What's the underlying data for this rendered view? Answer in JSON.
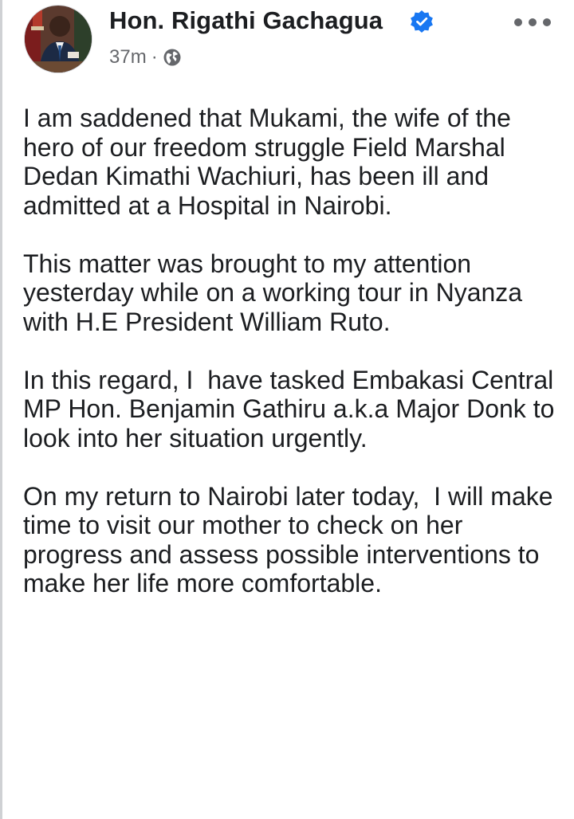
{
  "post": {
    "author": {
      "name": "Hon. Rigathi Gachagua",
      "verified": true,
      "avatar_icon": "profile-photo-icon"
    },
    "timestamp": "37m",
    "separator": "·",
    "audience_icon": "globe-icon",
    "more_icon": "more-options-icon",
    "colors": {
      "text": "#1c1e21",
      "meta": "#65676b",
      "verified_badge": "#1877f2"
    },
    "paragraphs": [
      "I am saddened that Mukami, the wife of the hero of our freedom struggle Field Marshal Dedan Kimathi Wachiuri, has been ill and admitted at a Hospital in Nairobi.",
      "This matter was brought to my attention yesterday while on a working tour in Nyanza with H.E President William Ruto.",
      "In this regard, I  have tasked Embakasi Central MP Hon. Benjamin Gathiru a.k.a Major Donk to look into her situation urgently.",
      "On my return to Nairobi later today,  I will make time to visit our mother to check on her progress and assess possible interventions to make her life more comfortable."
    ]
  }
}
